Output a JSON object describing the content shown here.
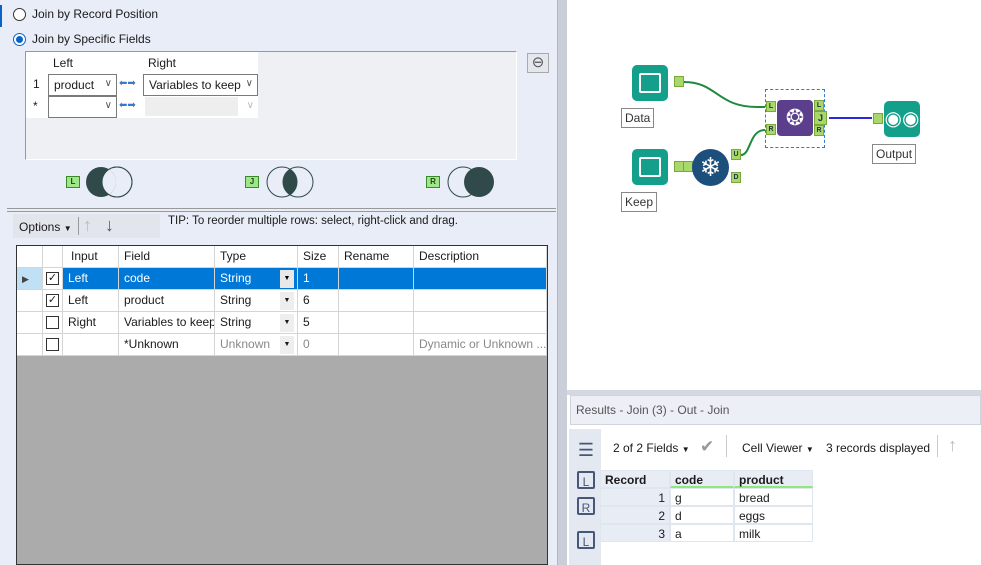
{
  "join_config": {
    "option_record_position": "Join by Record Position",
    "option_specific_fields": "Join by Specific Fields",
    "selected_option": "specific_fields",
    "fields_table": {
      "headers": {
        "left": "Left",
        "right": "Right"
      },
      "rows": [
        {
          "index": "1",
          "left": "product",
          "right": "Variables to keep"
        },
        {
          "index": "*",
          "left": "",
          "right": ""
        }
      ]
    },
    "venn_outputs": [
      {
        "anchor": "L"
      },
      {
        "anchor": "J"
      },
      {
        "anchor": "R"
      }
    ]
  },
  "select_toolbar": {
    "options_label": "Options",
    "tip": "TIP: To reorder multiple rows: select, right-click and drag."
  },
  "select_grid": {
    "headers": [
      "Input",
      "Field",
      "Type",
      "Size",
      "Rename",
      "Description"
    ],
    "rows": [
      {
        "checked": true,
        "input": "Left",
        "field": "code",
        "type": "String",
        "size": "1",
        "rename": "",
        "description": "",
        "selected": true
      },
      {
        "checked": true,
        "input": "Left",
        "field": "product",
        "type": "String",
        "size": "6",
        "rename": "",
        "description": ""
      },
      {
        "checked": false,
        "input": "Right",
        "field": "Variables to keep",
        "type": "String",
        "size": "5",
        "rename": "",
        "description": ""
      },
      {
        "checked": false,
        "input": "",
        "field": "*Unknown",
        "type": "Unknown",
        "size": "0",
        "rename": "",
        "description": "Dynamic or Unknown ..."
      }
    ]
  },
  "workflow": {
    "nodes": {
      "data": "Data",
      "keep": "Keep",
      "output": "Output"
    },
    "ports": {
      "left": "L",
      "right": "R",
      "join": "J",
      "unique": "U",
      "dup": "D"
    }
  },
  "results": {
    "title": "Results - Join (3) - Out - Join",
    "fields_selector": "2 of 2 Fields",
    "viewer": "Cell Viewer",
    "records_displayed": "3 records displayed",
    "headers": [
      "Record",
      "code",
      "product"
    ],
    "rows": [
      [
        "1",
        "g",
        "bread"
      ],
      [
        "2",
        "d",
        "eggs"
      ],
      [
        "3",
        "a",
        "milk"
      ]
    ],
    "side_icons": [
      "L",
      "R",
      "L"
    ]
  },
  "colors": {
    "accent": "#0078d7",
    "tool_teal": "#139f8a",
    "join_purple": "#5b3f8c",
    "unique_blue": "#1d4f7c"
  }
}
